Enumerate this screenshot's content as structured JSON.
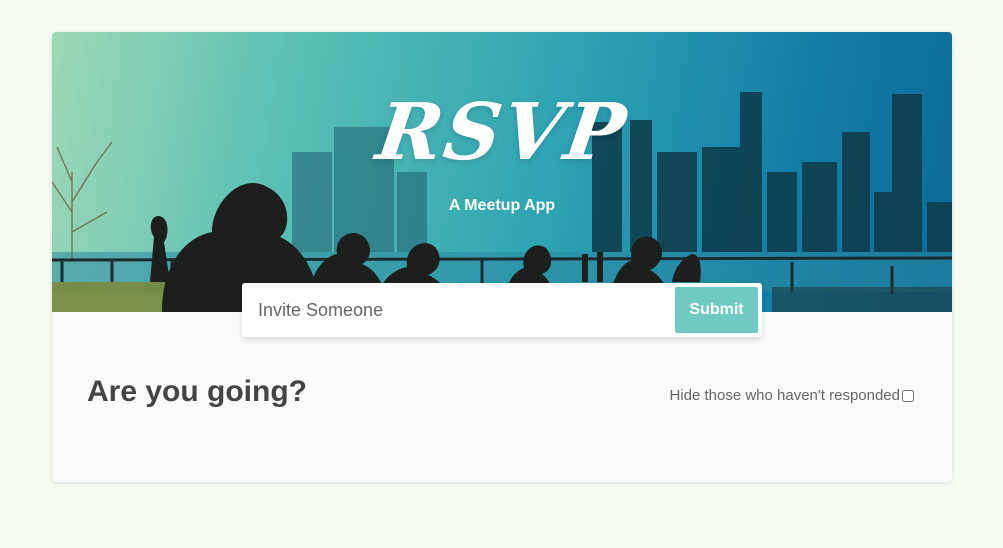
{
  "header": {
    "logo_text": "RSVP",
    "tagline": "A Meetup App"
  },
  "invite_form": {
    "placeholder": "Invite Someone",
    "value": "",
    "submit_label": "Submit"
  },
  "main": {
    "heading": "Are you going?",
    "filter_label": "Hide those who haven't responded",
    "filter_checked": false
  },
  "colors": {
    "page_background": "#f6fbf2",
    "card_background": "#fafafa",
    "accent": "#6fcbc2",
    "heading_text": "#444444"
  }
}
